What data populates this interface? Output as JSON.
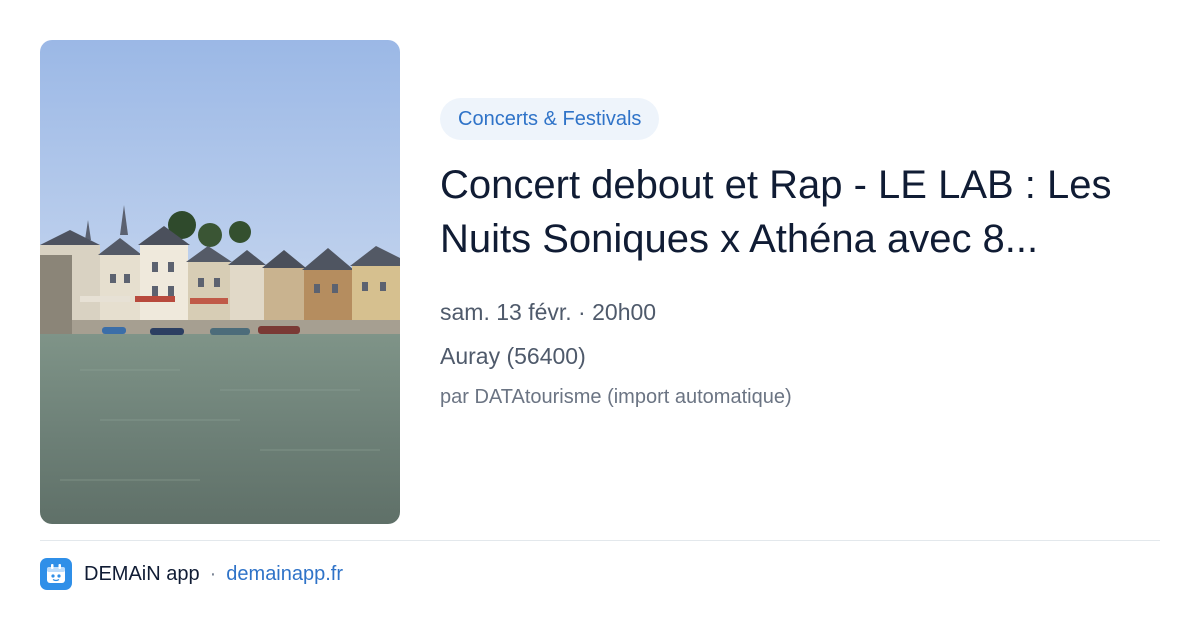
{
  "event": {
    "category": "Concerts & Festivals",
    "title": "Concert debout et Rap - LE LAB : Les Nuits Soniques x Athéna avec 8...",
    "date_time": "sam. 13 févr. · 20h00",
    "location": "Auray (56400)",
    "source": "par DATAtourisme (import automatique)"
  },
  "footer": {
    "app_name": "DEMAiN app",
    "separator": "·",
    "domain": "demainapp.fr"
  },
  "colors": {
    "accent": "#2f73c8",
    "pill_background": "#eef4fb",
    "title": "#101c34",
    "meta": "#4f5a6b",
    "logo": "#2f8fe8"
  },
  "icons": [
    "app-logo-icon"
  ]
}
